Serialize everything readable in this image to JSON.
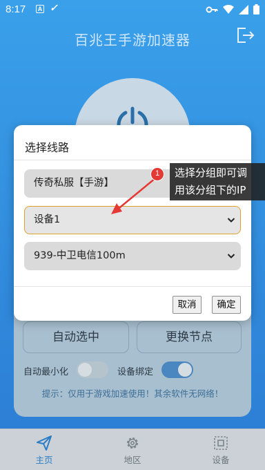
{
  "status_bar": {
    "time": "8:17",
    "a_icon_letter": "A"
  },
  "app": {
    "title": "百兆王手游加速器"
  },
  "main": {
    "auto_select_label": "自动选中",
    "switch_node_label": "更换节点",
    "auto_minimize_label": "自动最小化",
    "auto_minimize_on": false,
    "device_bind_label": "设备绑定",
    "device_bind_on": true,
    "tip": "提示：仅用于游戏加速使用！其余软件无网络！"
  },
  "dialog": {
    "title": "选择线路",
    "select_group_value": "传奇私服【手游】",
    "select_device_value": "设备1",
    "select_line_value": "939-中卫电信100m",
    "cancel_label": "取消",
    "ok_label": "确定"
  },
  "annotation": {
    "badge": "1",
    "tooltip_line1": "选择分组即可调",
    "tooltip_line2": "用该分组下的IP"
  },
  "bottom_nav": {
    "home_label": "主页",
    "region_label": "地区",
    "device_label": "设备"
  },
  "colors": {
    "accent": "#2a7cc4",
    "focus_border": "#e0a12c",
    "badge": "#e53935"
  }
}
